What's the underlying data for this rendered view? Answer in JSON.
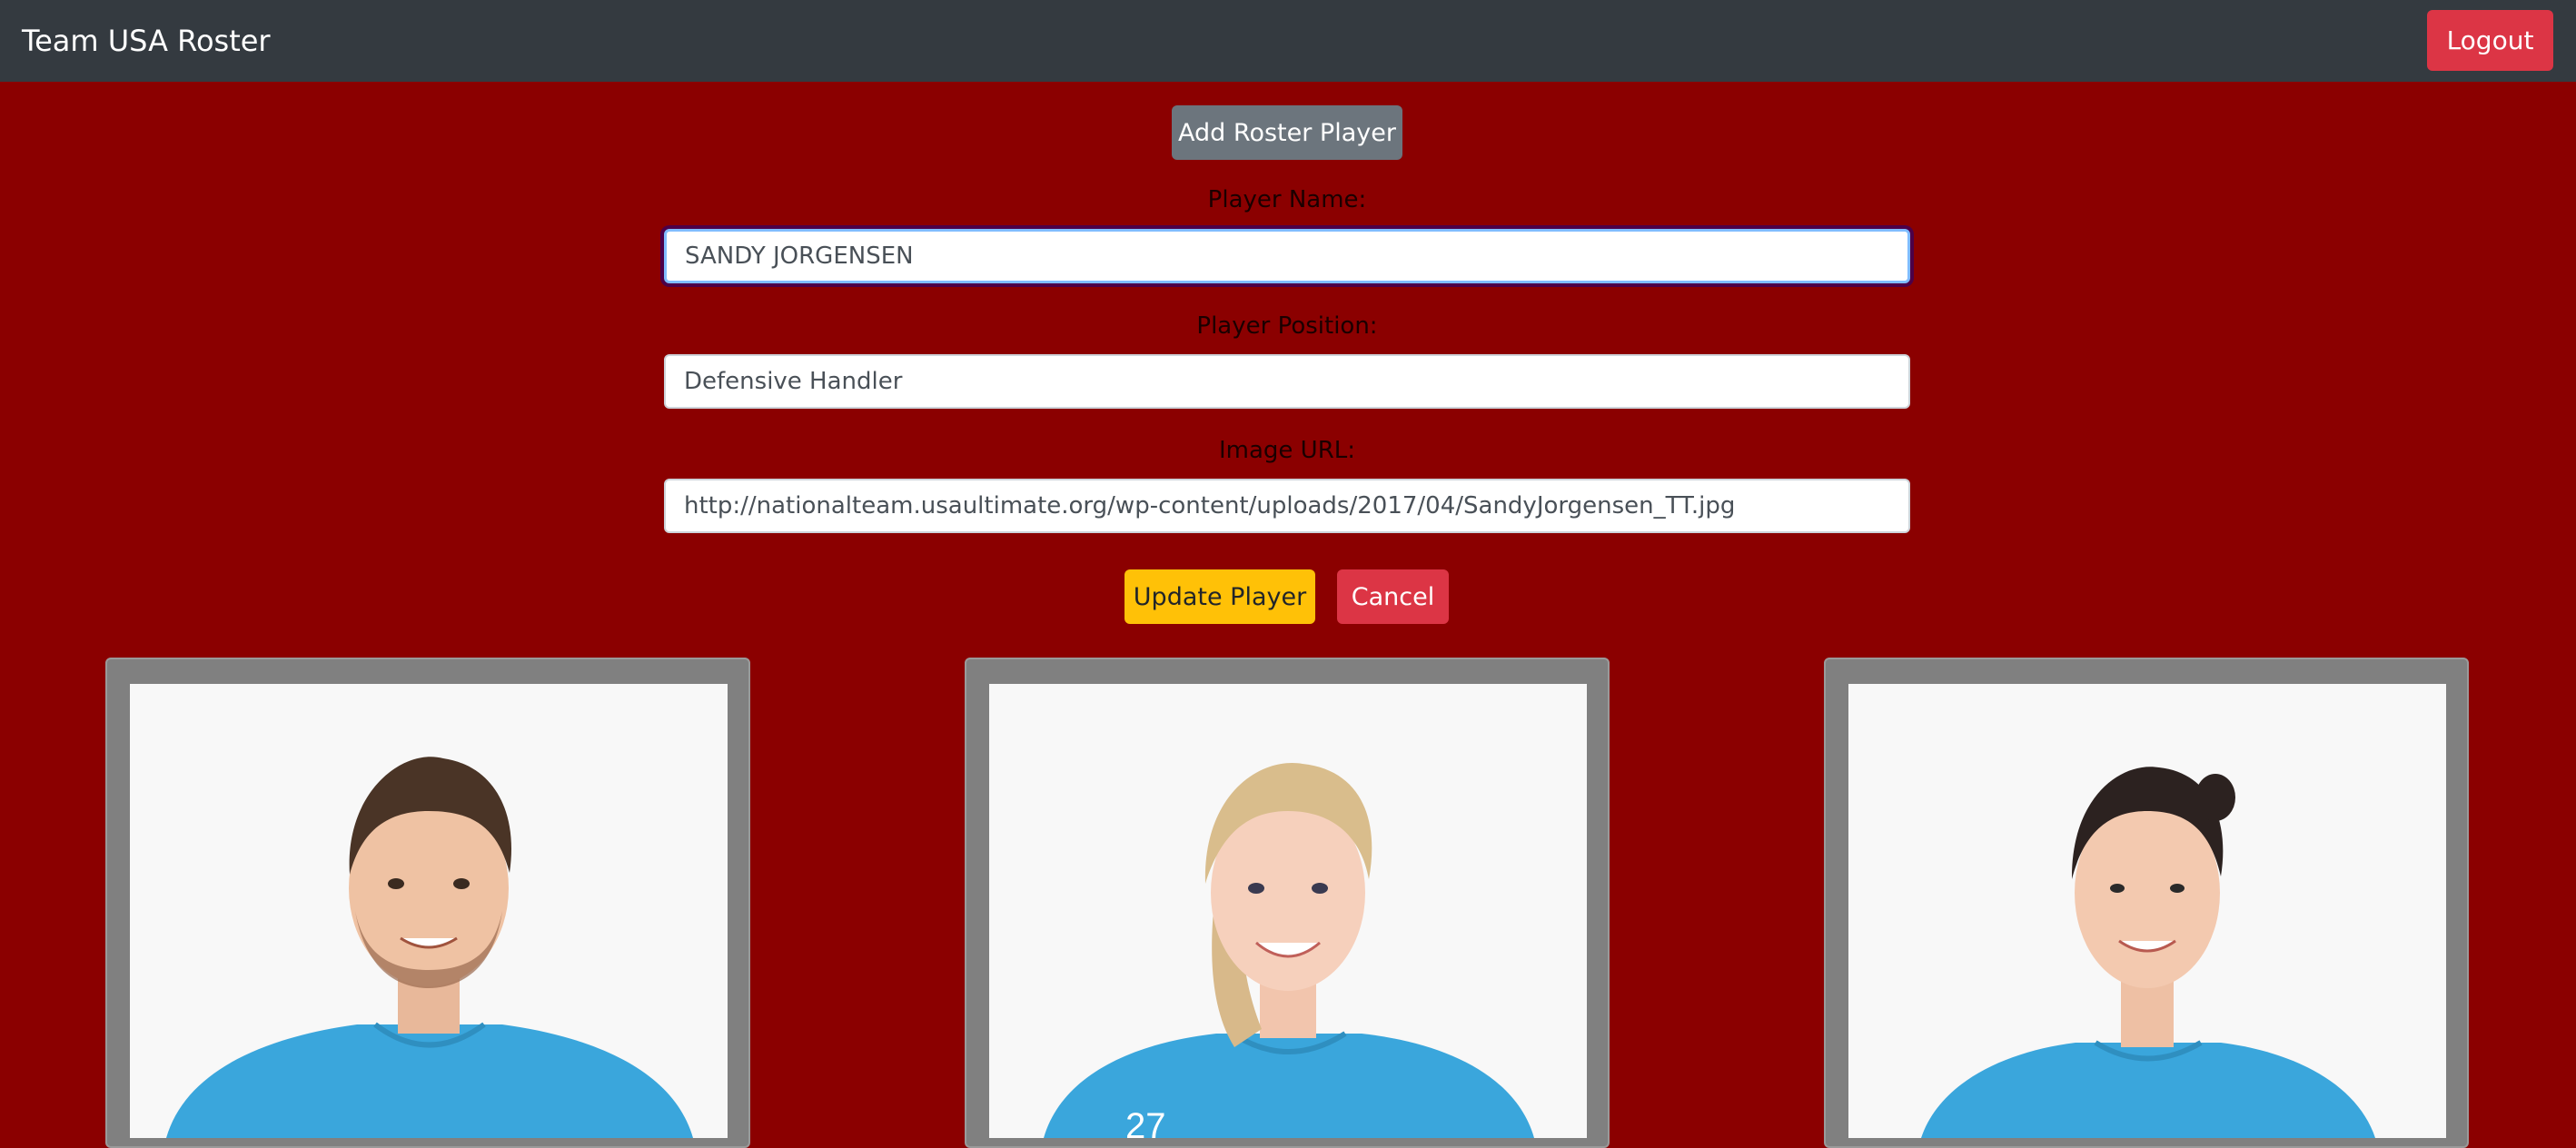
{
  "navbar": {
    "brand": "Team USA Roster",
    "logout_label": "Logout"
  },
  "form": {
    "add_button_label": "Add Roster Player",
    "name_label": "Player Name:",
    "name_value": "SANDY JORGENSEN",
    "position_label": "Player Position:",
    "position_value": "Defensive Handler",
    "image_label": "Image URL:",
    "image_value": "http://nationalteam.usaultimate.org/wp-content/uploads/2017/04/SandyJorgensen_TT.jpg",
    "update_label": "Update Player",
    "cancel_label": "Cancel"
  },
  "colors": {
    "page_background": "#8b0000",
    "navbar": "#343a40",
    "danger": "#dc3545",
    "warning": "#ffc107",
    "secondary": "#6c757d",
    "jersey": "#3aa6dc"
  },
  "players": [
    {
      "icon": "player-photo-1"
    },
    {
      "icon": "player-photo-2"
    },
    {
      "icon": "player-photo-3"
    }
  ]
}
